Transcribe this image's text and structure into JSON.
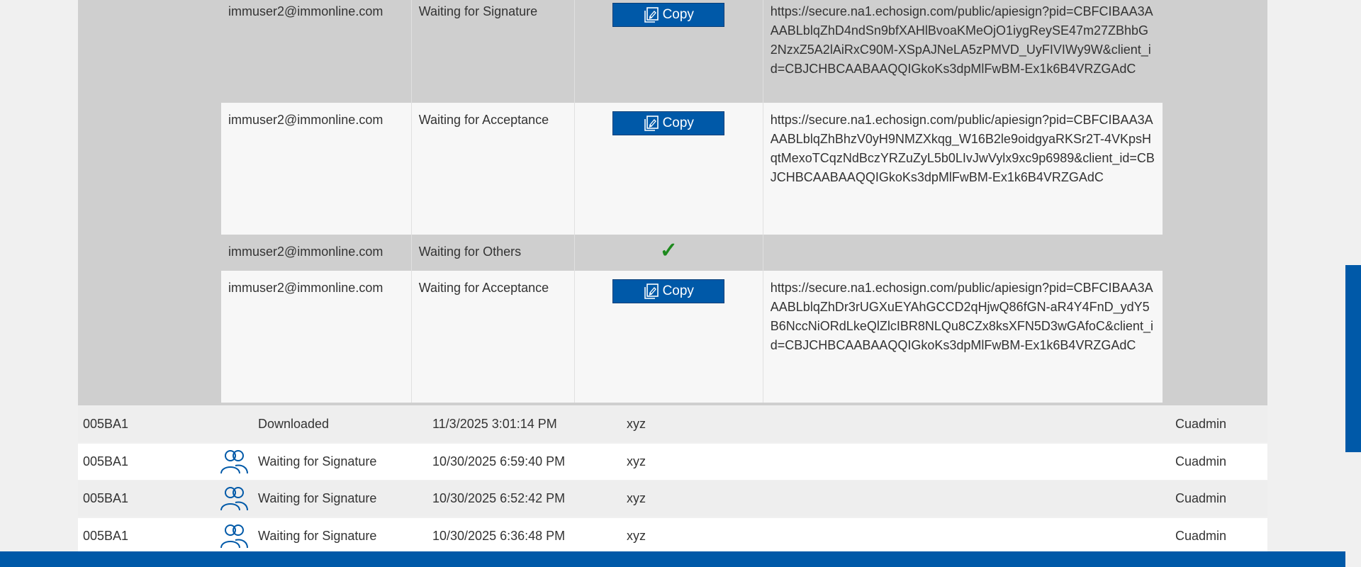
{
  "signers": [
    {
      "email": "immuser2@immonline.com",
      "status": "Waiting for Signature",
      "action": "copy",
      "url": "https://secure.na1.echosign.com/public/apiesign?pid=CBFCIBAA3AAABLblqZhD4ndSn9bfXAHlBvoaKMeOjO1iygReySE47m27ZBhbG2NzxZ5A2lAiRxC90M-XSpAJNeLA5zPMVD_UyFIVIWy9W&client_id=CBJCHBCAABAAQQIGkoKs3dpMlFwBM-Ex1k6B4VRZGAdC"
    },
    {
      "email": "immuser2@immonline.com",
      "status": "Waiting for Acceptance",
      "action": "copy",
      "url": "https://secure.na1.echosign.com/public/apiesign?pid=CBFCIBAA3AAABLblqZhBhzV0yH9NMZXkqg_W16B2le9oidgyaRKSr2T-4VKpsHqtMexoTCqzNdBczYRZuZyL5b0LIvJwVylx9xc9p6989&client_id=CBJCHBCAABAAQQIGkoKs3dpMlFwBM-Ex1k6B4VRZGAdC"
    },
    {
      "email": "immuser2@immonline.com",
      "status": "Waiting for Others",
      "action": "check",
      "url": ""
    },
    {
      "email": "immuser2@immonline.com",
      "status": "Waiting for Acceptance",
      "action": "copy",
      "url": "https://secure.na1.echosign.com/public/apiesign?pid=CBFCIBAA3AAABLblqZhDr3rUGXuEYAhGCCD2qHjwQ86fGN-aR4Y4FnD_ydY5B6NccNiORdLkeQlZlcIBR8NLQu8CZx8ksXFN5D3wGAfoC&client_id=CBJCHBCAABAAQQIGkoKs3dpMlFwBM-Ex1k6B4VRZGAdC"
    }
  ],
  "copy_label": "Copy",
  "check_glyph": "✓",
  "rows": [
    {
      "id": "005BA1",
      "icon": "",
      "status": "Downloaded",
      "date": "11/3/2025 3:01:14 PM",
      "name": "xyz",
      "user": "Cuadmin"
    },
    {
      "id": "005BA1",
      "icon": "users-icon",
      "status": "Waiting for Signature",
      "date": "10/30/2025 6:59:40 PM",
      "name": "xyz",
      "user": "Cuadmin"
    },
    {
      "id": "005BA1",
      "icon": "users-icon",
      "status": "Waiting for Signature",
      "date": "10/30/2025 6:52:42 PM",
      "name": "xyz",
      "user": "Cuadmin"
    },
    {
      "id": "005BA1",
      "icon": "users-icon",
      "status": "Waiting for Signature",
      "date": "10/30/2025 6:36:48 PM",
      "name": "xyz",
      "user": "Cuadmin"
    }
  ],
  "colors": {
    "accent": "#0059a8",
    "check": "#1e8a1e",
    "panel": "#cfcfcf"
  }
}
